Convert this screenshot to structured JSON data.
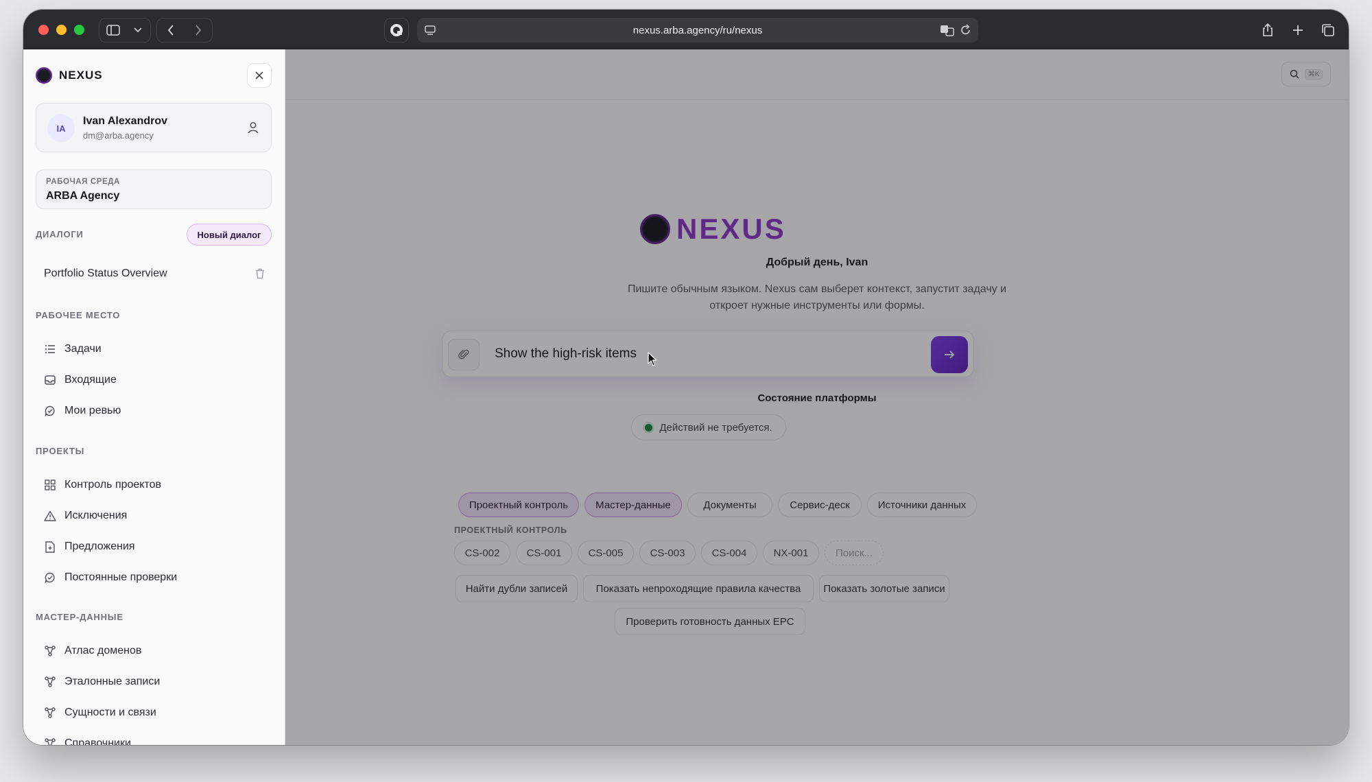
{
  "browser": {
    "url": "nexus.arba.agency/ru/nexus"
  },
  "sidebar": {
    "brand": "NEXUS",
    "user": {
      "initials": "IA",
      "name": "Ivan Alexandrov",
      "email": "dm@arba.agency"
    },
    "workspace": {
      "label": "РАБОЧАЯ СРЕДА",
      "value": "ARBA Agency"
    },
    "dialogs": {
      "title": "ДИАЛОГИ",
      "new_label": "Новый диалог",
      "items": [
        {
          "label": "Portfolio Status Overview"
        }
      ]
    },
    "workplace": {
      "title": "РАБОЧЕЕ МЕСТО",
      "items": [
        {
          "label": "Задачи",
          "icon": "list-icon"
        },
        {
          "label": "Входящие",
          "icon": "inbox-icon"
        },
        {
          "label": "Мои ревью",
          "icon": "chat-check-icon"
        }
      ]
    },
    "projects": {
      "title": "ПРОЕКТЫ",
      "items": [
        {
          "label": "Контроль проектов",
          "icon": "grid-icon"
        },
        {
          "label": "Исключения",
          "icon": "warning-icon"
        },
        {
          "label": "Предложения",
          "icon": "file-plus-icon"
        },
        {
          "label": "Постоянные проверки",
          "icon": "chat-check-icon"
        }
      ]
    },
    "master_data": {
      "title": "МАСТЕР-ДАННЫЕ",
      "items": [
        {
          "label": "Атлас доменов",
          "icon": "graph-icon"
        },
        {
          "label": "Эталонные записи",
          "icon": "graph-icon"
        },
        {
          "label": "Сущности и связи",
          "icon": "graph-icon"
        },
        {
          "label": "Справочники",
          "icon": "graph-icon"
        }
      ]
    }
  },
  "main": {
    "search_shortcut": "⌘K",
    "hero_name": "NEXUS",
    "greeting": "Добрый день, Ivan",
    "hint_line1": "Пишите обычным языком. Nexus сам выберет контекст, запустит задачу и",
    "hint_line2": "откроет нужные инструменты или формы.",
    "composer": {
      "value": "Show the high-risk items"
    },
    "status_title": "Состояние платформы",
    "status_text": "Действий не требуется.",
    "categories": [
      {
        "label": "Проектный контроль",
        "active": true
      },
      {
        "label": "Мастер-данные",
        "active": true
      },
      {
        "label": "Документы",
        "active": false
      },
      {
        "label": "Сервис-деск",
        "active": false
      },
      {
        "label": "Источники данных",
        "active": false
      }
    ],
    "project_control_title": "ПРОЕКТНЫЙ КОНТРОЛЬ",
    "project_codes": [
      "CS-002",
      "CS-001",
      "CS-005",
      "CS-003",
      "CS-004",
      "NX-001"
    ],
    "code_search_placeholder": "Поиск...",
    "actions": [
      "Найти дубли записей",
      "Показать непроходящие правила качества",
      "Показать золотые записи",
      "Проверить готовность данных EPC"
    ]
  },
  "colors": {
    "accent": "#7c3aed",
    "brand_text": "#8b34c9",
    "status_ok": "#15803d"
  }
}
